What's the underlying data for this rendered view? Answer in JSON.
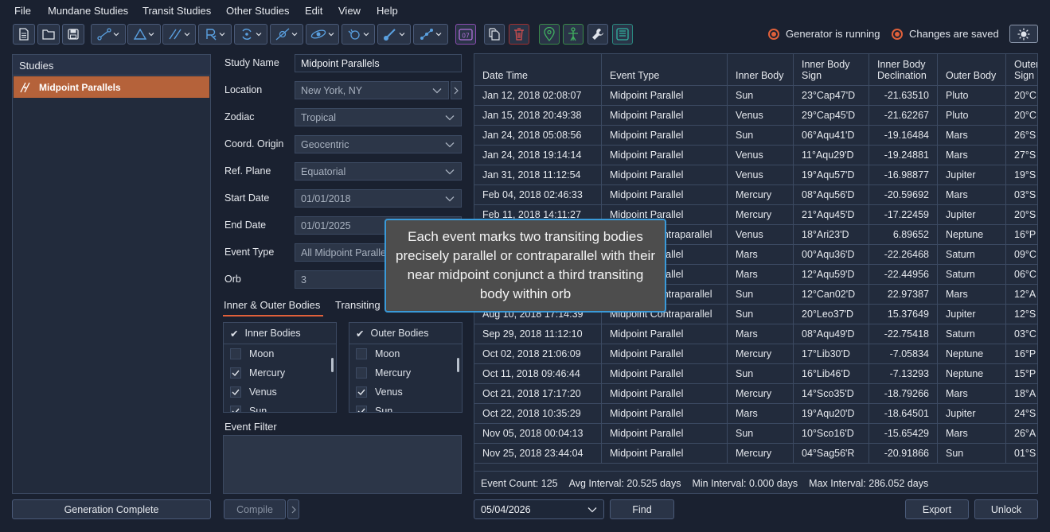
{
  "menu": [
    "File",
    "Mundane Studies",
    "Transit Studies",
    "Other Studies",
    "Edit",
    "View",
    "Help"
  ],
  "toolbar": {
    "icons": [
      "new-file-icon",
      "open-folder-icon",
      "save-icon",
      "aspect-icon",
      "triangle-icon",
      "parallel-icon",
      "retrograde-icon",
      "cycle-icon",
      "ingress-icon",
      "eclipse-icon",
      "lunar-icon",
      "station-icon",
      "midpoint-icon",
      "calendar-icon",
      "copy-icon",
      "delete-icon",
      "location-icon",
      "figure-icon",
      "wrench-icon",
      "export-db-icon"
    ],
    "calendar_label": "07"
  },
  "status": {
    "generator": "Generator is running",
    "saved": "Changes are saved"
  },
  "studies": {
    "header": "Studies",
    "items": [
      "Midpoint Parallels"
    ]
  },
  "form": {
    "study_name_label": "Study Name",
    "study_name": "Midpoint Parallels",
    "location_label": "Location",
    "location": "New York, NY",
    "zodiac_label": "Zodiac",
    "zodiac": "Tropical",
    "coord_label": "Coord. Origin",
    "coord": "Geocentric",
    "ref_plane_label": "Ref. Plane",
    "ref_plane": "Equatorial",
    "start_date_label": "Start Date",
    "start_date": "01/01/2018",
    "end_date_label": "End Date",
    "end_date": "01/01/2025",
    "event_type_label": "Event Type",
    "event_type": "All Midpoint Paralle",
    "orb_label": "Orb",
    "orb": "3"
  },
  "tabs": [
    "Inner & Outer Bodies",
    "Transiting"
  ],
  "inner_bodies": {
    "header": "Inner Bodies",
    "rows": [
      {
        "name": "Moon",
        "checked": false
      },
      {
        "name": "Mercury",
        "checked": true
      },
      {
        "name": "Venus",
        "checked": true
      },
      {
        "name": "Sun",
        "checked": true
      }
    ]
  },
  "outer_bodies": {
    "header": "Outer Bodies",
    "rows": [
      {
        "name": "Moon",
        "checked": false
      },
      {
        "name": "Mercury",
        "checked": false
      },
      {
        "name": "Venus",
        "checked": true
      },
      {
        "name": "Sun",
        "checked": true
      }
    ]
  },
  "event_filter_label": "Event Filter",
  "buttons": {
    "generation": "Generation Complete",
    "compile": "Compile",
    "find": "Find",
    "export": "Export",
    "unlock": "Unlock"
  },
  "find_date": "05/04/2026",
  "table": {
    "columns": [
      "Date Time",
      "Event Type",
      "Inner Body",
      "Inner Body\nSign",
      "Inner Body\nDeclination",
      "Outer Body",
      "Outer\nSign"
    ],
    "rows": [
      [
        "Jan 12, 2018 02:08:07",
        "Midpoint Parallel",
        "Sun",
        "23°Cap47'D",
        "-21.63510",
        "Pluto",
        "20°C"
      ],
      [
        "Jan 15, 2018 20:49:38",
        "Midpoint Parallel",
        "Venus",
        "29°Cap45'D",
        "-21.62267",
        "Pluto",
        "20°C"
      ],
      [
        "Jan 24, 2018 05:08:56",
        "Midpoint Parallel",
        "Sun",
        "06°Aqu41'D",
        "-19.16484",
        "Mars",
        "26°S"
      ],
      [
        "Jan 24, 2018 19:14:14",
        "Midpoint Parallel",
        "Venus",
        "11°Aqu29'D",
        "-19.24881",
        "Mars",
        "27°S"
      ],
      [
        "Jan 31, 2018 11:12:54",
        "Midpoint Parallel",
        "Venus",
        "19°Aqu57'D",
        "-16.98877",
        "Jupiter",
        "19°S"
      ],
      [
        "Feb 04, 2018 02:46:33",
        "Midpoint Parallel",
        "Mercury",
        "08°Aqu56'D",
        "-20.59692",
        "Mars",
        "03°S"
      ],
      [
        "Feb 11, 2018 14:11:27",
        "Midpoint Parallel",
        "Mercury",
        "21°Aqu45'D",
        "-17.22459",
        "Jupiter",
        "20°S"
      ],
      [
        "",
        "Midpoint Contraparallel",
        "Venus",
        "18°Ari23'D",
        "6.89652",
        "Neptune",
        "16°P"
      ],
      [
        "",
        "Midpoint Parallel",
        "Mars",
        "00°Aqu36'D",
        "-22.26468",
        "Saturn",
        "09°C"
      ],
      [
        "",
        "Midpoint Parallel",
        "Mars",
        "12°Aqu59'D",
        "-22.44956",
        "Saturn",
        "06°C"
      ],
      [
        "",
        "Midpoint Contraparallel",
        "Sun",
        "12°Can02'D",
        "22.97387",
        "Mars",
        "12°A"
      ],
      [
        "Aug 10, 2018 17:14:39",
        "Midpoint Contraparallel",
        "Sun",
        "20°Leo37'D",
        "15.37649",
        "Jupiter",
        "12°S"
      ],
      [
        "Sep 29, 2018 11:12:10",
        "Midpoint Parallel",
        "Mars",
        "08°Aqu49'D",
        "-22.75418",
        "Saturn",
        "03°C"
      ],
      [
        "Oct 02, 2018 21:06:09",
        "Midpoint Parallel",
        "Mercury",
        "17°Lib30'D",
        "-7.05834",
        "Neptune",
        "16°P"
      ],
      [
        "Oct 11, 2018 09:46:44",
        "Midpoint Parallel",
        "Sun",
        "16°Lib46'D",
        "-7.13293",
        "Neptune",
        "15°P"
      ],
      [
        "Oct 21, 2018 17:17:20",
        "Midpoint Parallel",
        "Mercury",
        "14°Sco35'D",
        "-18.79266",
        "Mars",
        "18°A"
      ],
      [
        "Oct 22, 2018 10:35:29",
        "Midpoint Parallel",
        "Mars",
        "19°Aqu20'D",
        "-18.64501",
        "Jupiter",
        "24°S"
      ],
      [
        "Nov 05, 2018 00:04:13",
        "Midpoint Parallel",
        "Sun",
        "10°Sco16'D",
        "-15.65429",
        "Mars",
        "26°A"
      ],
      [
        "Nov 25, 2018 23:44:04",
        "Midpoint Parallel",
        "Mercury",
        "04°Sag56'R",
        "-20.91866",
        "Sun",
        "01°S"
      ]
    ]
  },
  "footer": {
    "event_count": "Event Count:  125",
    "avg_interval": "Avg Interval:  20.525 days",
    "min_interval": "Min Interval:  0.000 days",
    "max_interval": "Max Interval:  286.052 days"
  },
  "tooltip": "Each event marks two transiting bodies precisely parallel or contraparallel with their near midpoint conjunct a third transiting body within orb"
}
